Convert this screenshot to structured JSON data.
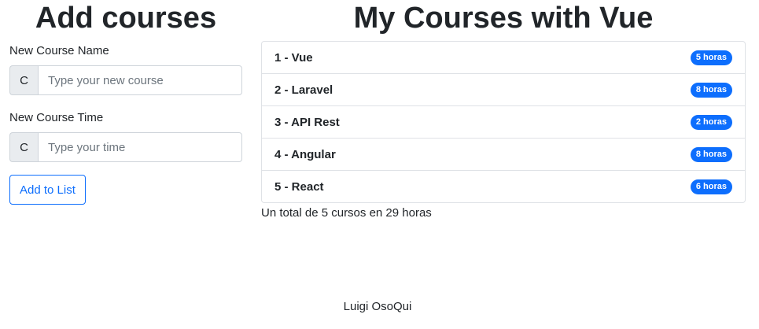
{
  "add_section": {
    "title": "Add courses",
    "name_label": "New Course Name",
    "name_prefix": "C",
    "name_placeholder": "Type your new course",
    "time_label": "New Course Time",
    "time_prefix": "C",
    "time_placeholder": "Type your time",
    "add_button_label": "Add to List"
  },
  "courses_section": {
    "title": "My Courses with Vue",
    "courses": [
      {
        "label": "1 - Vue",
        "badge": "5 horas"
      },
      {
        "label": "2 - Laravel",
        "badge": "8 horas"
      },
      {
        "label": "3 - API Rest",
        "badge": "2 horas"
      },
      {
        "label": "4 - Angular",
        "badge": "8 horas"
      },
      {
        "label": "5 - React",
        "badge": "6 horas"
      }
    ],
    "total_text": "Un total de 5 cursos en 29 horas"
  },
  "footer": {
    "author": "Luigi OsoQui"
  },
  "colors": {
    "accent": "#0d6efd",
    "text": "#212529",
    "input_prefix_bg": "#e9ecef"
  }
}
